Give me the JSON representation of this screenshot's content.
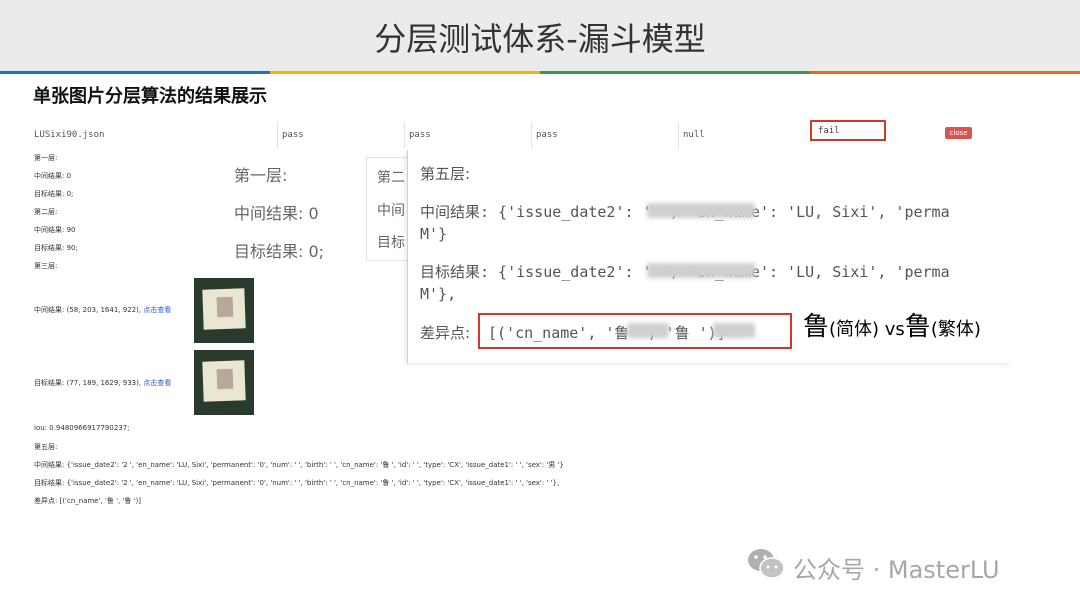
{
  "title": "分层测试体系-漏斗模型",
  "stripe_colors": [
    "#1a73c8",
    "#f4b400",
    "#2f9e44",
    "#ea6a1b"
  ],
  "subtitle": "单张图片分层算法的结果展示",
  "result_row": {
    "file": "LUSixi90.json",
    "cells": [
      "pass",
      "pass",
      "pass",
      "null",
      "fail"
    ],
    "close_label": "close"
  },
  "left_log": {
    "layer1": "第一层:",
    "mid1": "中间结果: 0",
    "tgt1": "目标结果: 0;",
    "layer2": "第二层:",
    "mid2": "中间结果: 90",
    "tgt2": "目标结果: 90;",
    "layer3": "第三层:",
    "mid3": "中间结果: (58, 203, 1641, 922),",
    "tgt3": "目标结果: (77, 189, 1629, 933),",
    "view_link": "点击查看",
    "iou": "iou: 0.9480966917790237;",
    "layer5": "第五层:",
    "mid5": "中间结果: {'issue_date2': '2  ', 'en_name': 'LU, Sixi', 'permanent': '0', 'num': '  ', 'birth': '  ', 'cn_name': '鲁  ', 'id': '  ', 'type': 'CX', 'issue_date1': '  ', 'sex': '男 '}",
    "tgt5": "目标结果: {'issue_date2': '2  ', 'en_name': 'LU, Sixi', 'permanent': '0', 'num': '  ', 'birth': '  ', 'cn_name': '鲁  ', 'id': '  ', 'type': 'CX', 'issue_date1': '  ', 'sex': ' '},",
    "diff5": "差异点: [('cn_name', '鲁  ', '鲁  ')]"
  },
  "zoom_a": {
    "layer": "第一层:",
    "mid": "中间结果: 0",
    "tgt": "目标结果: 0;"
  },
  "zoom_b": {
    "layer": "第二",
    "mid": "中间",
    "tgt": "目标"
  },
  "zoom_c": {
    "layer": "第五层:",
    "mid_line1": "中间结果: {'issue_date2': '   ', 'en_name': 'LU, Sixi', 'perma",
    "mid_line2": "M'}",
    "tgt_line1": "目标结果: {'issue_date2': '   ', 'en_name': 'LU, Sixi', 'perma",
    "tgt_line2": "M'},",
    "diff_label": "差异点:",
    "diff_value": "[('cn_name', '鲁  ', '鲁  ')]"
  },
  "annotation": {
    "char1": "鲁",
    "note1": "(简体) vs",
    "char2": "鲁",
    "note2": "(繁体)"
  },
  "footer": "公众号 · MasterLU"
}
